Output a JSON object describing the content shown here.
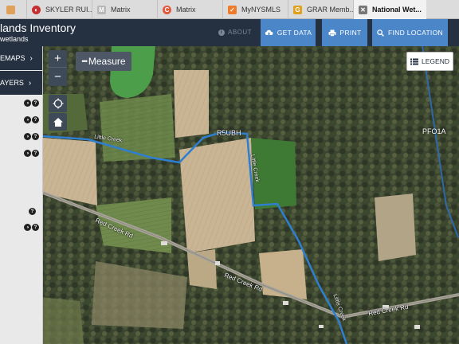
{
  "browser": {
    "tabs": [
      {
        "label": "",
        "icon": "house-favicon-icon",
        "color": "#e0a15a"
      },
      {
        "label": "SKYLER RUI...",
        "icon": "skyler-favicon-icon",
        "color": "#c62f2f"
      },
      {
        "label": "Matrix",
        "icon": "matrix-m-favicon-icon",
        "color": "#b8b8b8"
      },
      {
        "label": "Matrix",
        "icon": "matrix-c-favicon-icon",
        "color": "#e05a3a"
      },
      {
        "label": "MyNYSMLS",
        "icon": "mynysmls-favicon-icon",
        "color": "#f07a2a"
      },
      {
        "label": "GRAR Memb...",
        "icon": "grar-favicon-icon",
        "color": "#e0a020"
      },
      {
        "label": "National Wet...",
        "icon": "national-wetlands-favicon-icon",
        "color": "#777777",
        "active": true
      }
    ]
  },
  "header": {
    "title": "lands Inventory",
    "subtitle": "wetlands",
    "about_label": "ABOUT",
    "get_data_label": "GET DATA",
    "print_label": "PRINT",
    "find_location_label": "FIND LOCATION"
  },
  "sidebar": {
    "maps_label": "EMAPS",
    "layers_label": "AYERS"
  },
  "map": {
    "measure_label": "Measure",
    "legend_label": "LEGEND",
    "labels": {
      "rsubh": "R5UBH",
      "pfo1a": "PFO1A",
      "little_creek_1": "Little Creek",
      "little_creek_2": "Little Creek",
      "little_creek_3": "Little Creek",
      "red_creek_rd_1": "Red Creek Rd",
      "red_creek_rd_2": "Red Creek Rd",
      "red_creek_rd_3": "Red Creek Rd"
    }
  },
  "colors": {
    "header_bg": "#253140",
    "button_blue": "#4b86c9",
    "stream_blue": "#2f7fd0"
  }
}
